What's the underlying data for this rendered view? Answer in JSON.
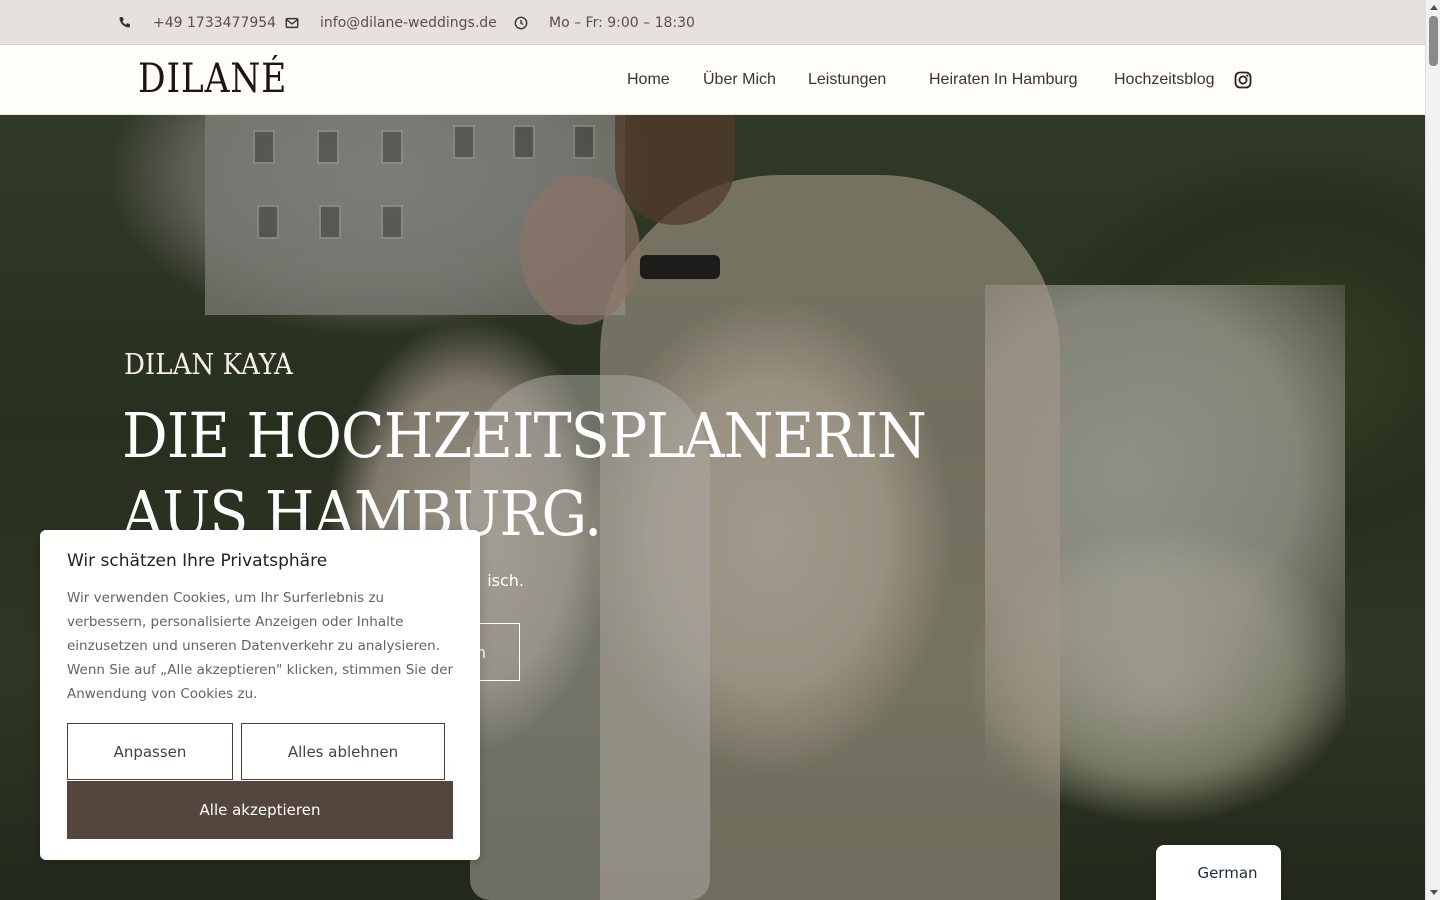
{
  "topbar": {
    "phone": "+49 1733477954",
    "email": "info@dilane-weddings.de",
    "hours": "Mo – Fr: 9:00 – 18:30",
    "icons": [
      "phone-icon",
      "envelope-icon",
      "clock-icon"
    ]
  },
  "header": {
    "logo": "DILANÉ",
    "nav": [
      "Home",
      "Über Mich",
      "Leistungen",
      "Heiraten In Hamburg",
      "Hochzeitsblog"
    ],
    "social_icon": "instagram-icon"
  },
  "hero": {
    "eyebrow": "DILAN KAYA",
    "headline": "DIE HOCHZEITSPLANERIN AUS HAMBURG.",
    "subline_visible": "isch.",
    "cta_visible": "n"
  },
  "cookie": {
    "title": "Wir schätzen Ihre Privatsphäre",
    "text": "Wir verwenden Cookies, um Ihr Surferlebnis zu verbessern, personalisierte Anzeigen oder Inhalte einzusetzen und unseren Datenverkehr zu analysieren. Wenn Sie auf „Alle akzeptieren\" klicken, stimmen Sie der Anwendung von Cookies zu.",
    "customize": "Anpassen",
    "reject_all": "Alles ablehnen",
    "accept_all": "Alle akzeptieren",
    "accent_color": "#54463c"
  },
  "language": {
    "current": "German"
  }
}
